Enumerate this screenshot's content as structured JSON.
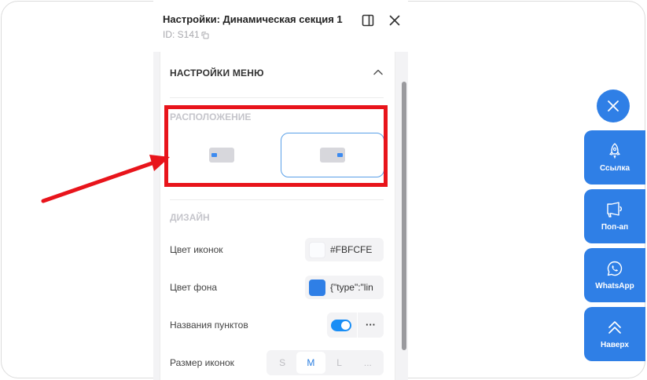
{
  "panel": {
    "title": "Настройки: Динамическая секция 1",
    "id_label": "ID: S141"
  },
  "menu_settings": {
    "title": "НАСТРОЙКИ МЕНЮ",
    "placement": {
      "label": "РАСПОЛОЖЕНИЕ",
      "selected": "right"
    },
    "design": {
      "label": "ДИЗАЙН",
      "icon_color": {
        "label": "Цвет иконок",
        "value": "#FBFCFE",
        "swatch": "#FBFCFE"
      },
      "bg_color": {
        "label": "Цвет фона",
        "value": "{\"type\":\"lin",
        "swatch": "#2f7fe6"
      },
      "item_names": {
        "label": "Названия пунктов",
        "enabled": true,
        "more_label": "···"
      },
      "icon_size": {
        "label": "Размер иконок",
        "options": [
          "S",
          "M",
          "L",
          "..."
        ],
        "selected": "M"
      }
    }
  },
  "widget": {
    "accent": "#2f7fe6",
    "buttons": [
      {
        "label": "Ссылка",
        "icon": "rocket-icon"
      },
      {
        "label": "Поп-ап",
        "icon": "megaphone-icon"
      },
      {
        "label": "WhatsApp",
        "icon": "whatsapp-icon"
      },
      {
        "label": "Наверх",
        "icon": "double-chevron-up-icon"
      }
    ]
  },
  "annotation": {
    "color": "#e8141b"
  }
}
